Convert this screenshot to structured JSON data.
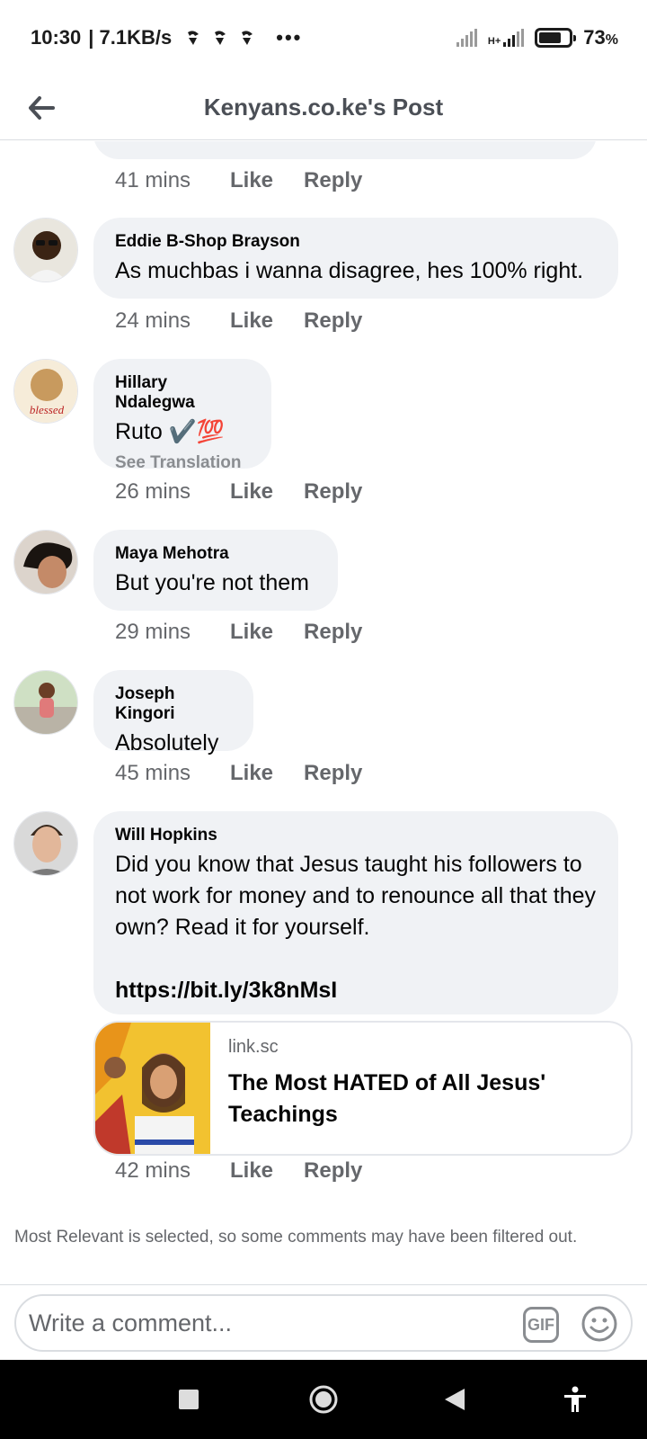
{
  "status_bar": {
    "time": "10:30",
    "network_speed": "| 7.1KB/s",
    "dots": "•••",
    "network_type": "H+",
    "battery_percent": "73",
    "battery_unit": "%",
    "battery_level": 0.73
  },
  "header": {
    "title": "Kenyans.co.ke's Post",
    "back_icon": "arrow-left-icon"
  },
  "comments": [
    {
      "author": "",
      "text": "",
      "time": "41 mins",
      "like": "Like",
      "reply": "Reply"
    },
    {
      "author": "Eddie B-Shop Brayson",
      "text": "As muchbas i wanna disagree, hes 100% right.",
      "time": "24 mins",
      "like": "Like",
      "reply": "Reply"
    },
    {
      "author": "Hillary Ndalegwa",
      "text": "Ruto ✔️💯",
      "see_translation": "See Translation",
      "time": "26 mins",
      "like": "Like",
      "reply": "Reply"
    },
    {
      "author": "Maya Mehotra",
      "text": "But you're not them",
      "time": "29 mins",
      "like": "Like",
      "reply": "Reply"
    },
    {
      "author": "Joseph Kingori",
      "text": "Absolutely",
      "time": "45 mins",
      "like": "Like",
      "reply": "Reply"
    },
    {
      "author": "Will Hopkins",
      "text": "Did you know that Jesus taught his followers to not work for money and to renounce all that they own?  Read it for yourself.",
      "link": "https://bit.ly/3k8nMsI",
      "link_preview": {
        "domain": "link.sc",
        "title": "The Most HATED of All Jesus' Teachings"
      },
      "time": "42 mins",
      "like": "Like",
      "reply": "Reply"
    }
  ],
  "filter_note": "Most Relevant is selected, so some comments may have been filtered out.",
  "composer": {
    "placeholder": "Write a comment...",
    "gif_label": "GIF"
  },
  "colors": {
    "bubble": "#f0f2f5",
    "secondary_text": "#65676b",
    "header_text": "#4b4f56"
  }
}
